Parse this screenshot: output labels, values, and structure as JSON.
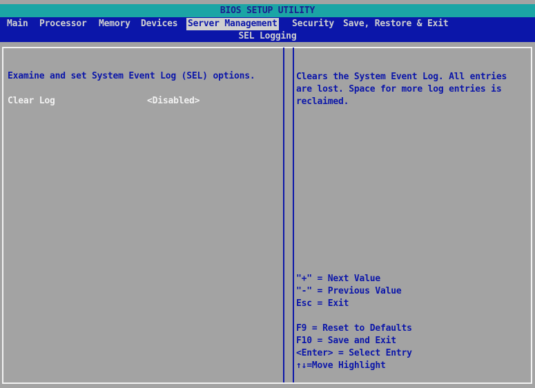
{
  "title": "BIOS SETUP UTILITY",
  "menu": {
    "tabs": [
      {
        "label": "Main"
      },
      {
        "label": "Processor"
      },
      {
        "label": "Memory"
      },
      {
        "label": "Devices"
      },
      {
        "label": "Server Management"
      },
      {
        "label": "Security"
      },
      {
        "label": "Save, Restore & Exit"
      }
    ],
    "active_tab": "Server Management"
  },
  "page": {
    "subtitle": "SEL Logging",
    "description": "Examine and set System Event Log (SEL) options.",
    "settings": [
      {
        "label": "Clear Log",
        "value": "<Disabled>"
      }
    ]
  },
  "help": {
    "description_lines": [
      "Clears the System Event Log.  All entries",
      "are lost.  Space for more log entries is",
      "reclaimed."
    ],
    "keys_group1": [
      "\"+\" = Next Value",
      "\"-\" = Previous Value",
      "Esc = Exit"
    ],
    "keys_group2": [
      "F9 = Reset to Defaults",
      "F10 = Save and Exit",
      "<Enter> = Select Entry",
      "↑↓=Move Highlight"
    ]
  },
  "colors": {
    "background": "#a3a3a3",
    "title_bar": "#1ba5a5",
    "menu_bar": "#0b16a9",
    "text_blue": "#0b16a9",
    "text_light": "#f2f2f2"
  }
}
